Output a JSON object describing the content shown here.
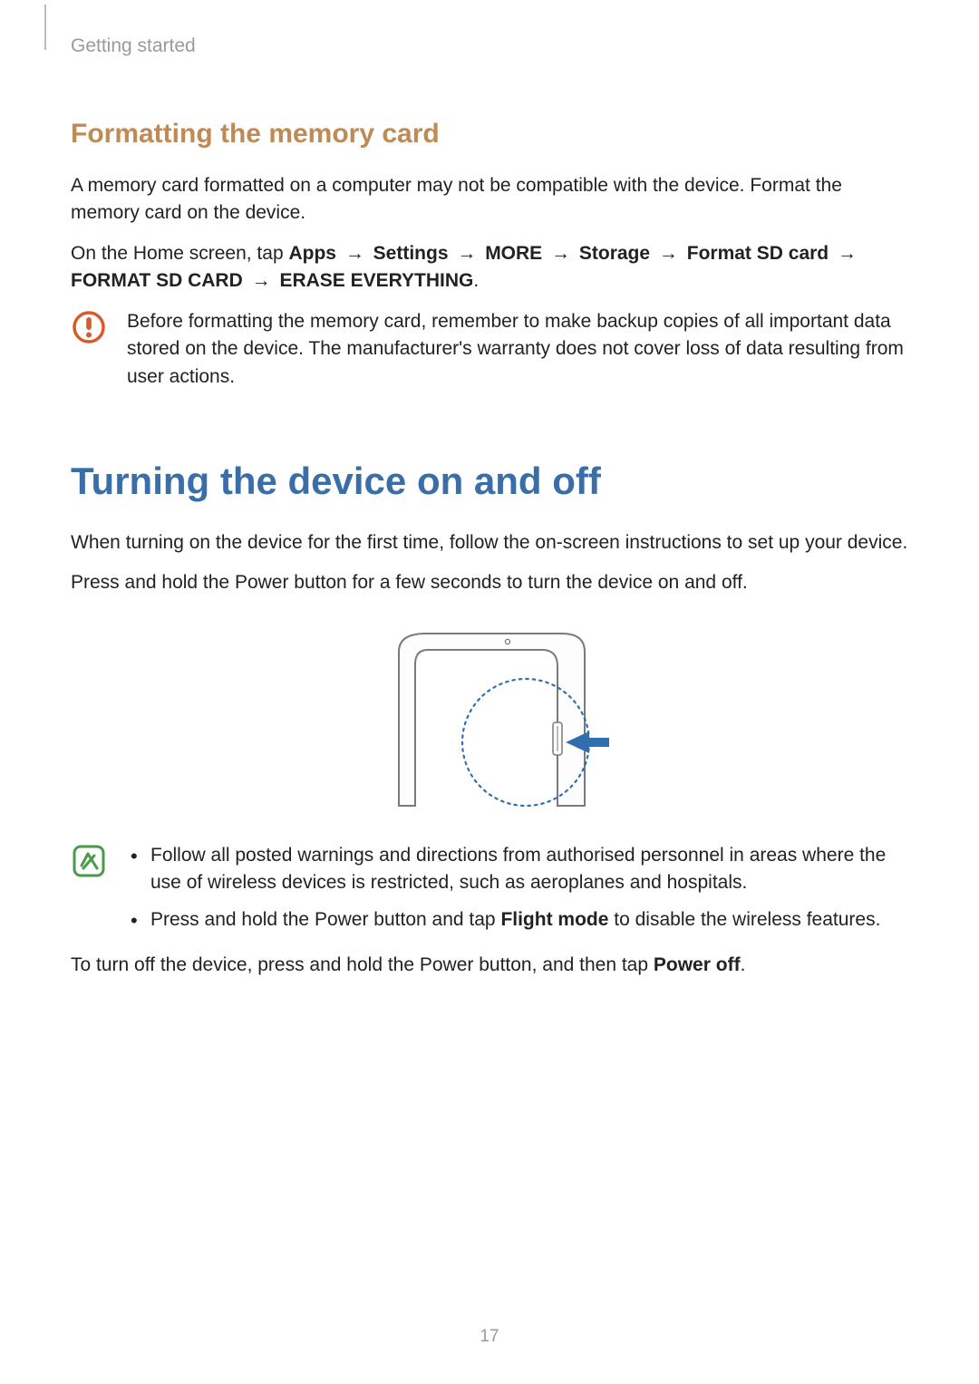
{
  "running_head": "Getting started",
  "section1": {
    "heading": "Formatting the memory card",
    "p1": "A memory card formatted on a computer may not be compatible with the device. Format the memory card on the device.",
    "p2_parts": {
      "lead": "On the Home screen, tap ",
      "apps": "Apps",
      "settings": "Settings",
      "more": "MORE",
      "storage": "Storage",
      "format_sd": "Format SD card",
      "format_sd_caps": "FORMAT SD CARD",
      "erase": "ERASE EVERYTHING",
      "period": "."
    },
    "caution": "Before formatting the memory card, remember to make backup copies of all important data stored on the device. The manufacturer's warranty does not cover loss of data resulting from user actions."
  },
  "section2": {
    "heading": "Turning the device on and off",
    "p1": "When turning on the device for the first time, follow the on-screen instructions to set up your device.",
    "p2": "Press and hold the Power button for a few seconds to turn the device on and off.",
    "notes": {
      "n1": "Follow all posted warnings and directions from authorised personnel in areas where the use of wireless devices is restricted, such as aeroplanes and hospitals.",
      "n2a": "Press and hold the Power button and tap ",
      "n2b": "Flight mode",
      "n2c": " to disable the wireless features."
    },
    "p3a": "To turn off the device, press and hold the Power button, and then tap ",
    "p3b": "Power off",
    "p3c": "."
  },
  "arrow": "→",
  "page_number": "17"
}
